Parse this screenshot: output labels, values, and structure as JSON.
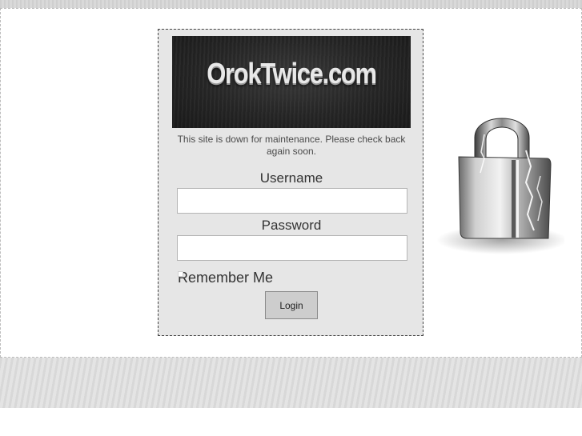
{
  "banner": {
    "logo_text": "OrokTwice.com"
  },
  "notice": {
    "text": "This site is down for maintenance. Please check back again soon."
  },
  "form": {
    "username_label": "Username",
    "username_value": "",
    "password_label": "Password",
    "password_value": "",
    "remember_label": "Remember Me",
    "remember_checked": false,
    "login_label": "Login"
  },
  "icons": {
    "padlock": "padlock-icon"
  },
  "colors": {
    "background": "#ffffff",
    "form_panel": "#e6e6e6",
    "banner": "#262626"
  }
}
